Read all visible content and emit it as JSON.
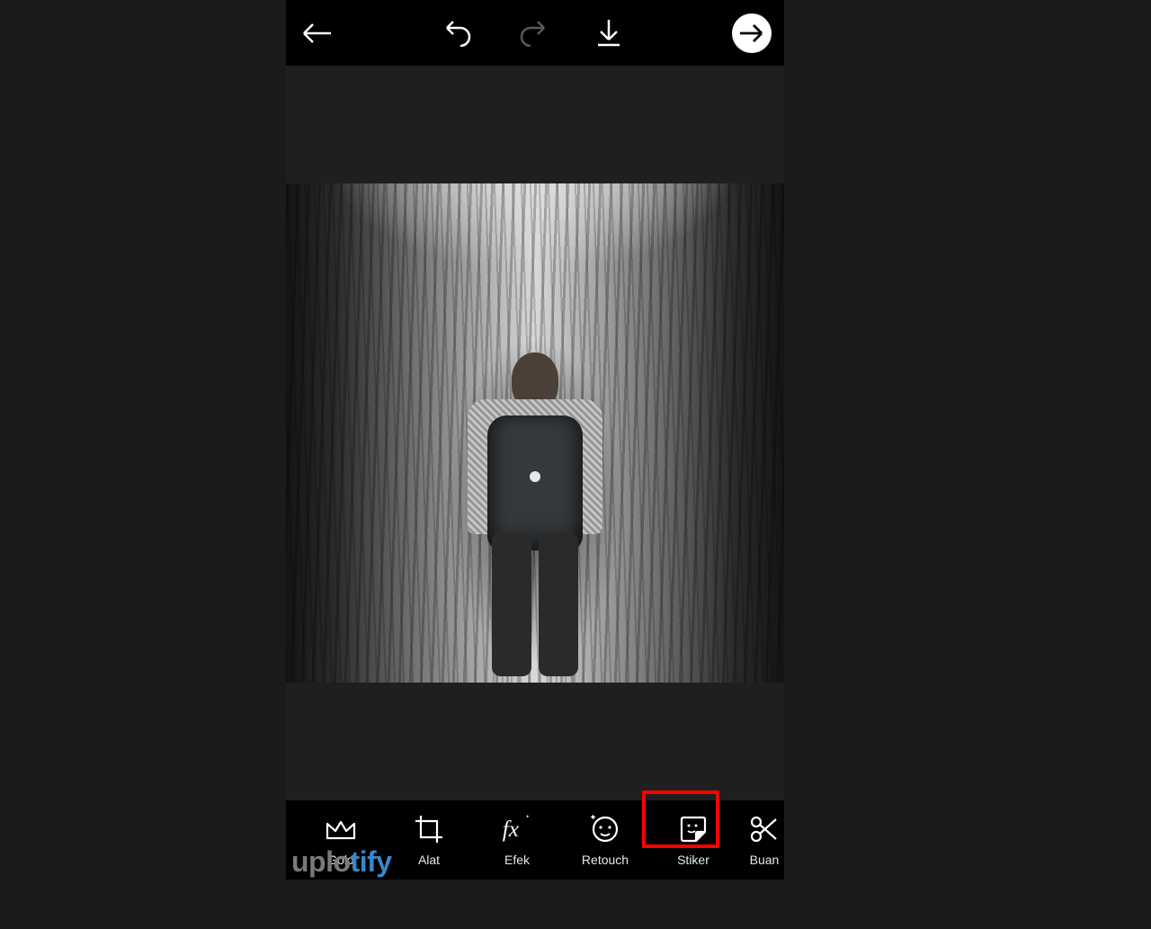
{
  "topbar": {
    "back_icon": "back",
    "undo_icon": "undo",
    "redo_icon": "redo",
    "download_icon": "download",
    "next_icon": "next"
  },
  "tools": [
    {
      "id": "gold",
      "label": "Gold",
      "icon": "crown"
    },
    {
      "id": "alat",
      "label": "Alat",
      "icon": "crop"
    },
    {
      "id": "efek",
      "label": "Efek",
      "icon": "fx"
    },
    {
      "id": "retouch",
      "label": "Retouch",
      "icon": "face"
    },
    {
      "id": "stiker",
      "label": "Stiker",
      "icon": "sticker",
      "highlighted": true
    },
    {
      "id": "buan",
      "label": "Buan",
      "icon": "cut"
    }
  ],
  "watermark": {
    "part1": "uplo",
    "part2": "tify"
  },
  "colors": {
    "highlight": "#ff0000",
    "accent_blue": "#3b86c9",
    "bg": "#1a1a1a"
  }
}
